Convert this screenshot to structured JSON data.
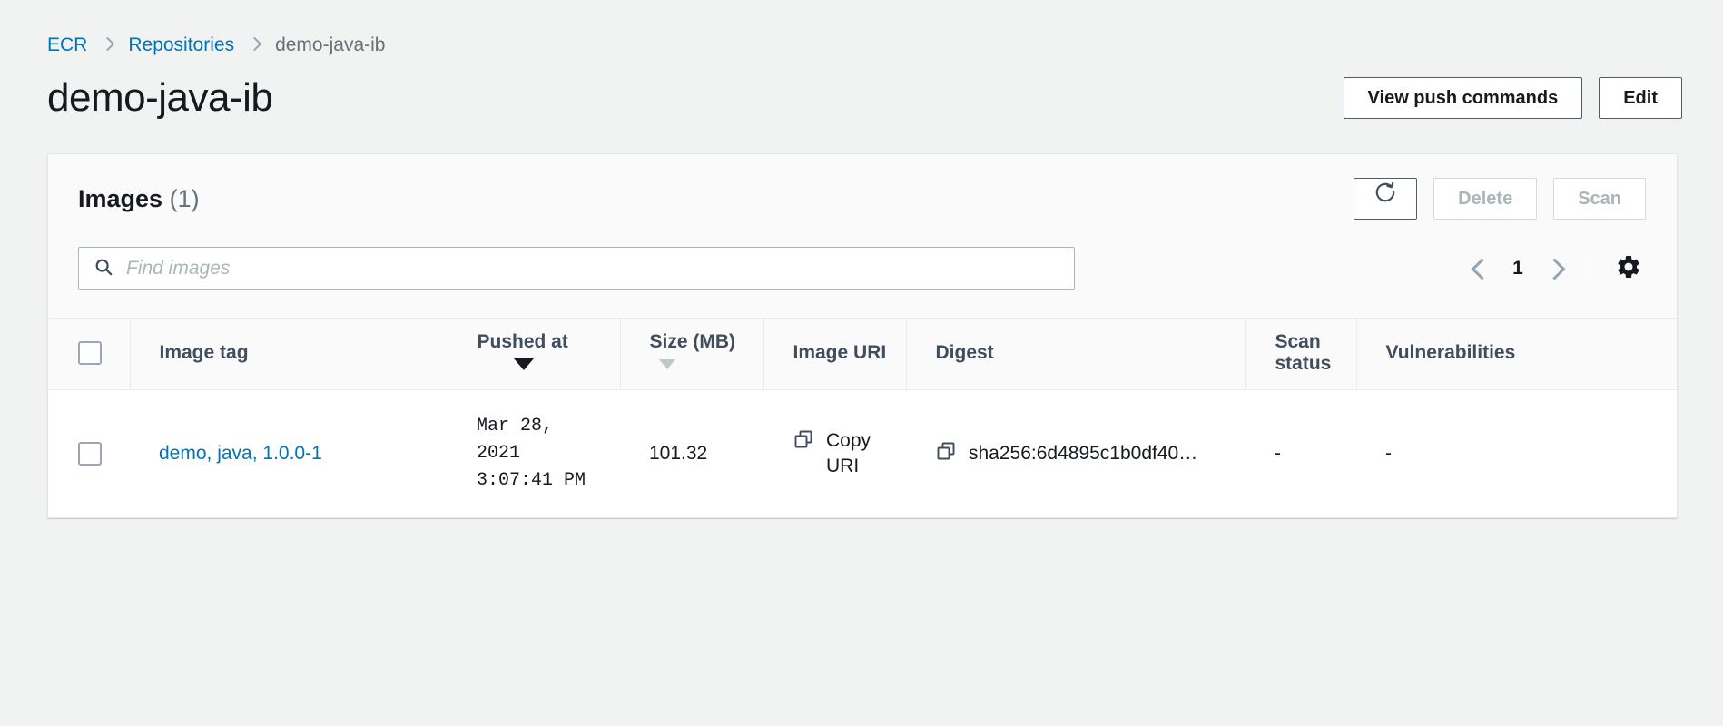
{
  "breadcrumb": {
    "items": [
      {
        "label": "ECR",
        "type": "link"
      },
      {
        "label": "Repositories",
        "type": "link"
      },
      {
        "label": "demo-java-ib",
        "type": "current"
      }
    ]
  },
  "page": {
    "title": "demo-java-ib",
    "actions": [
      {
        "label": "View push commands",
        "name": "view-push-commands-button",
        "disabled": false
      },
      {
        "label": "Edit",
        "name": "edit-button",
        "disabled": false
      }
    ]
  },
  "card": {
    "title": "Images",
    "count": "(1)",
    "actions": {
      "refresh_icon": "refresh-icon",
      "delete_label": "Delete",
      "scan_label": "Scan"
    }
  },
  "search": {
    "placeholder": "Find images",
    "value": "",
    "icon": "search-icon"
  },
  "pagination": {
    "prev_icon": "chevron-left-icon",
    "page": "1",
    "next_icon": "chevron-right-icon",
    "settings_icon": "gear-icon"
  },
  "table": {
    "columns": [
      {
        "label": "Image tag",
        "sort": "none"
      },
      {
        "label": "Pushed at",
        "sort": "desc-active"
      },
      {
        "label": "Size (MB)",
        "sort": "desc-inactive"
      },
      {
        "label": "Image URI",
        "sort": "none"
      },
      {
        "label": "Digest",
        "sort": "none"
      },
      {
        "label": "Scan status",
        "sort": "none"
      },
      {
        "label": "Vulnerabilities",
        "sort": "none"
      }
    ],
    "rows": [
      {
        "image_tag": "demo, java, 1.0.0-1",
        "pushed_at": "Mar 28, 2021 3:07:41 PM",
        "size_mb": "101.32",
        "image_uri": "Copy URI",
        "digest": "sha256:6d4895c1b0df40…",
        "scan_status": "-",
        "vulnerabilities": "-"
      }
    ]
  },
  "colors": {
    "link": "#0073bb",
    "page_background": "#f1f3f3",
    "card_background": "#ffffff",
    "header_background": "#fafafa",
    "text": "#16191f",
    "muted": "#687078",
    "disabled": "#aab7b8"
  }
}
